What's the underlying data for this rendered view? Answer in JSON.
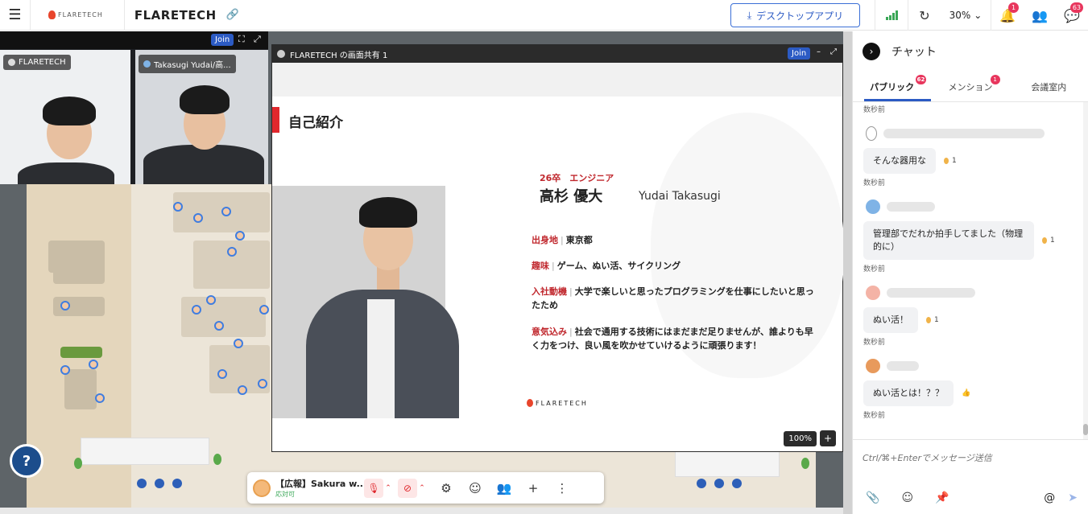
{
  "topbar": {
    "brand_logo_text": "FLARETECH",
    "title": "FLARETECH",
    "desktop_app_label": "デスクトップアプリ",
    "zoom": "30%",
    "notification_count": "1",
    "chat_count": "63",
    "signal_color": "#3aa757"
  },
  "video_strip": {
    "join_label": "Join",
    "tiles": [
      {
        "label": "FLARETECH"
      },
      {
        "label": "Takasugi Yudai/高..."
      }
    ]
  },
  "share": {
    "title": "FLARETECH の画面共有 1",
    "join_label": "Join",
    "zoom": "100%",
    "zoom_plus": "+",
    "slide": {
      "heading": "自己紹介",
      "role": "26卒　エンジニア",
      "name_jp": "高杉 優大",
      "name_en": "Yudai Takasugi",
      "fields": [
        {
          "key": "出身地",
          "value": "東京都"
        },
        {
          "key": "趣味",
          "value": "ゲーム、ぬい活、サイクリング"
        },
        {
          "key": "入社動機",
          "value": "大学で楽しいと思ったプログラミングを仕事にしたいと思ったため"
        },
        {
          "key": "意気込み",
          "value": "社会で通用する技術にはまだまだ足りませんが、誰よりも早く力をつけ、良い風を吹かせていけるように頑張ります！"
        }
      ],
      "logo_text": "FLARETECH",
      "accent_color": "#e0282d"
    }
  },
  "controls": {
    "user_name": "【広報】Sakura w...",
    "user_status": "応対可"
  },
  "chat": {
    "title": "チャット",
    "tabs": [
      {
        "label": "パブリック",
        "badge": "62"
      },
      {
        "label": "メンション",
        "badge": "1"
      },
      {
        "label": "会議室内",
        "badge": ""
      }
    ],
    "messages": [
      {
        "time_before": "数秒前",
        "text": "そんな器用な",
        "reaction_count": "1",
        "time": "数秒前"
      },
      {
        "text": "管理部でだれか拍手してました（物理的に）",
        "reaction_count": "1",
        "time": "数秒前"
      },
      {
        "text": "ぬい活！",
        "reaction_count": "1",
        "time": "数秒前"
      },
      {
        "text": "ぬい活とは！？？",
        "reaction_count": "",
        "time": "数秒前"
      }
    ],
    "input_placeholder": "Ctrl/⌘+Enterでメッセージ送信"
  },
  "colors": {
    "brand_blue": "#2c5bc4",
    "badge_red": "#e8365d"
  }
}
